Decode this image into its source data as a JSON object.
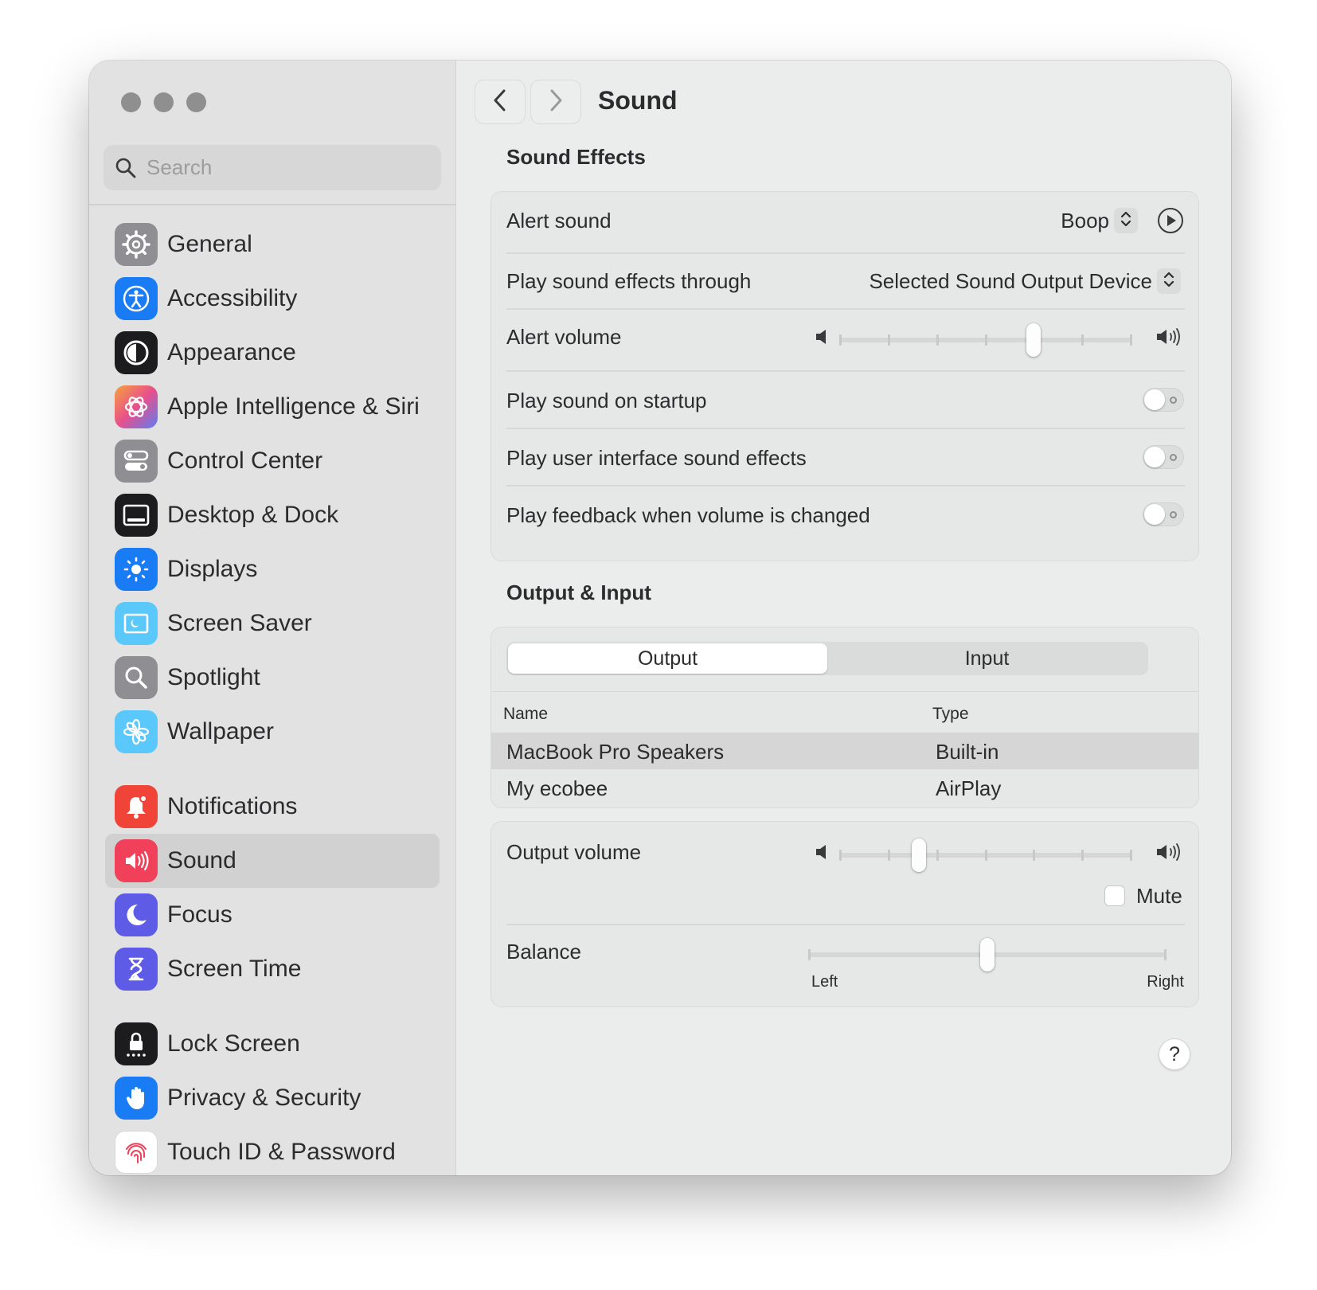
{
  "window": {
    "title": "Sound"
  },
  "search": {
    "placeholder": "Search",
    "icon": "magnifying-glass"
  },
  "sidebar": {
    "items": [
      {
        "label": "General",
        "icon": "gear-icon",
        "color": "#8e8e93"
      },
      {
        "label": "Accessibility",
        "icon": "accessibility-icon",
        "color": "#1a7cf5"
      },
      {
        "label": "Appearance",
        "icon": "appearance-icon",
        "color": "#1c1c1e"
      },
      {
        "label": "Apple Intelligence & Siri",
        "icon": "siri-icon",
        "color": "#e86b8c"
      },
      {
        "label": "Control Center",
        "icon": "control-center-icon",
        "color": "#8e8e93"
      },
      {
        "label": "Desktop & Dock",
        "icon": "dock-icon",
        "color": "#1c1c1e"
      },
      {
        "label": "Displays",
        "icon": "sun-icon",
        "color": "#1a7cf5"
      },
      {
        "label": "Screen Saver",
        "icon": "screen-saver-icon",
        "color": "#5ac8fa"
      },
      {
        "label": "Spotlight",
        "icon": "spotlight-icon",
        "color": "#8e8e93"
      },
      {
        "label": "Wallpaper",
        "icon": "flower-icon",
        "color": "#5ac8fa"
      },
      {
        "label": "Notifications",
        "icon": "bell-icon",
        "color": "#f04438"
      },
      {
        "label": "Sound",
        "icon": "speaker-icon",
        "color": "#f0405a",
        "selected": true
      },
      {
        "label": "Focus",
        "icon": "moon-icon",
        "color": "#5e5ce6"
      },
      {
        "label": "Screen Time",
        "icon": "hourglass-icon",
        "color": "#5e5ce6"
      },
      {
        "label": "Lock Screen",
        "icon": "lock-icon",
        "color": "#1c1c1e"
      },
      {
        "label": "Privacy & Security",
        "icon": "hand-icon",
        "color": "#1a7cf5"
      },
      {
        "label": "Touch ID & Password",
        "icon": "fingerprint-icon",
        "color": "#ffffff"
      }
    ]
  },
  "sound_effects": {
    "title": "Sound Effects",
    "alert_sound": {
      "label": "Alert sound",
      "value": "Boop"
    },
    "play_through": {
      "label": "Play sound effects through",
      "value": "Selected Sound Output Device"
    },
    "alert_volume": {
      "label": "Alert volume",
      "level": 0.67
    },
    "startup": {
      "label": "Play sound on startup",
      "on": false
    },
    "ui_effects": {
      "label": "Play user interface sound effects",
      "on": false
    },
    "feedback": {
      "label": "Play feedback when volume is changed",
      "on": false
    }
  },
  "output_input": {
    "title": "Output & Input",
    "tabs": [
      "Output",
      "Input"
    ],
    "active_tab": "Output",
    "columns": [
      "Name",
      "Type"
    ],
    "devices": [
      {
        "name": "MacBook Pro Speakers",
        "type": "Built-in",
        "selected": true
      },
      {
        "name": "My ecobee",
        "type": "AirPlay",
        "selected": false
      }
    ]
  },
  "output_volume": {
    "label": "Output volume",
    "level": 0.26,
    "mute_label": "Mute",
    "muted": false
  },
  "balance": {
    "label": "Balance",
    "left_label": "Left",
    "right_label": "Right",
    "level": 0.5
  },
  "help": {
    "label": "?"
  }
}
